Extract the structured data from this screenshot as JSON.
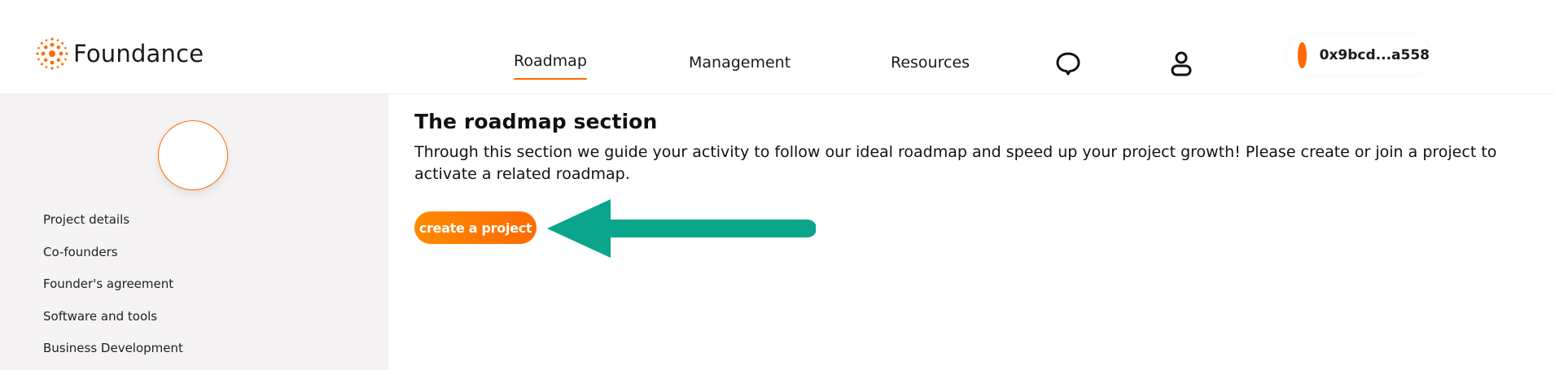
{
  "header": {
    "brand": "Foundance",
    "nav": {
      "roadmap": "Roadmap",
      "management": "Management",
      "resources": "Resources"
    },
    "wallet": {
      "address": "0x9bcd...a558",
      "color": "#ff6a00"
    }
  },
  "sidebar": {
    "items": [
      {
        "label": "Project details"
      },
      {
        "label": "Co-founders"
      },
      {
        "label": "Founder's agreement"
      },
      {
        "label": "Software and tools"
      },
      {
        "label": "Business Development"
      }
    ]
  },
  "main": {
    "title": "The roadmap section",
    "description": "Through this section we guide your activity to follow our ideal roadmap and speed up your project growth! Please create or join a project to activate a related roadmap.",
    "create_button": "create a project"
  },
  "colors": {
    "accent": "#ff6a00",
    "arrow": "#0aa58a",
    "sidebar_bg": "#f5f3f3"
  },
  "icons": [
    "logo-icon",
    "chat-icon",
    "user-icon",
    "arrow-pointer-icon"
  ]
}
